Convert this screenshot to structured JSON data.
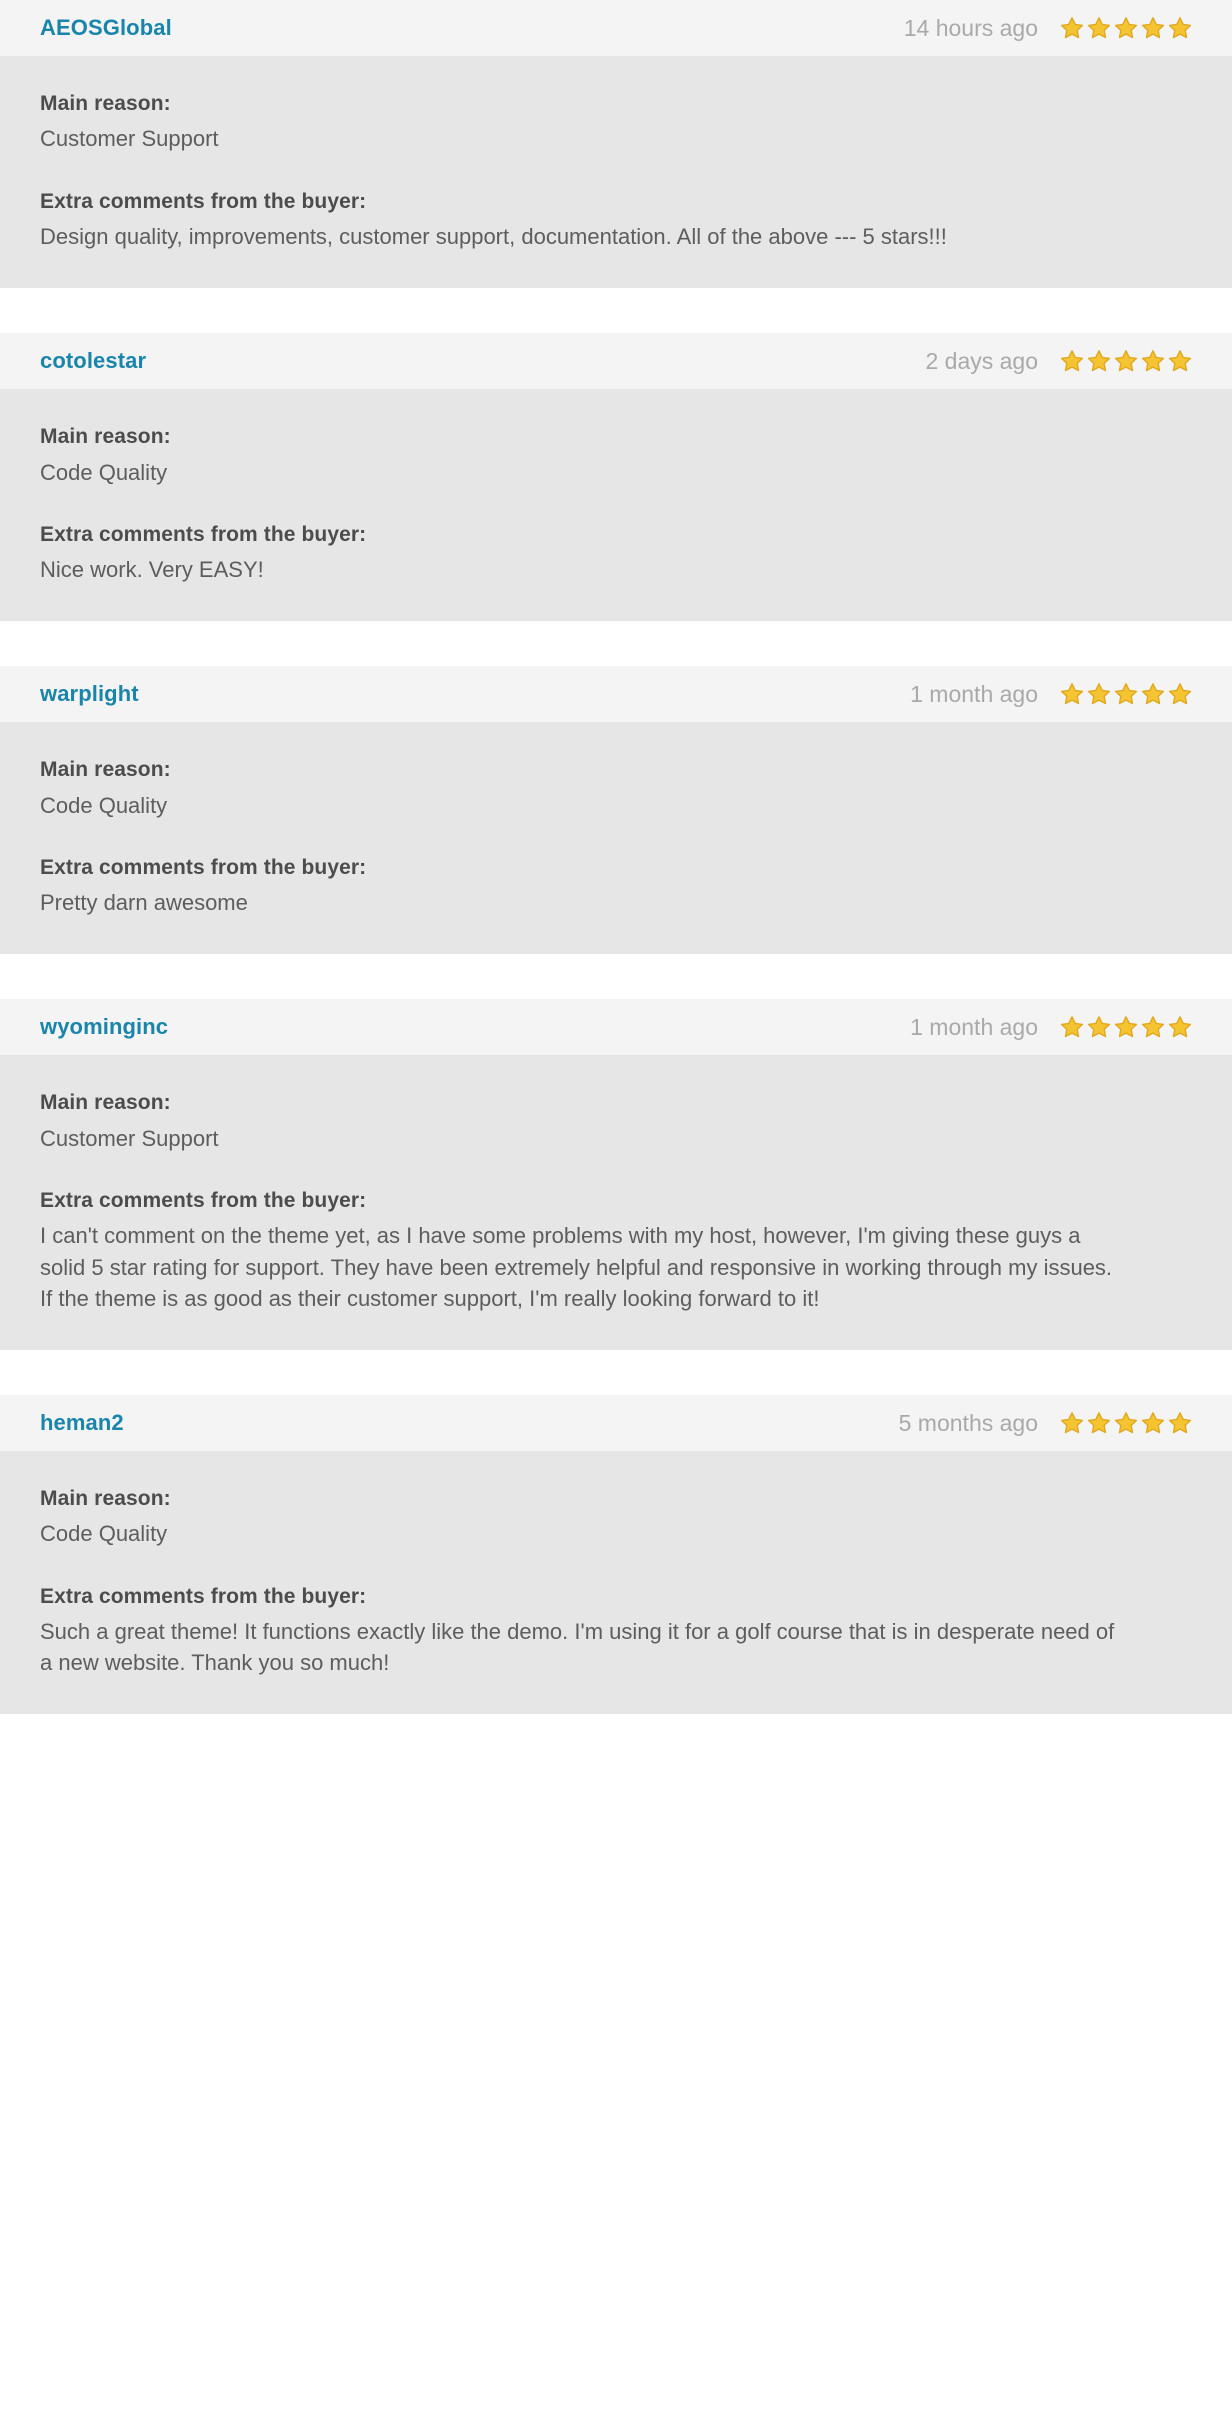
{
  "labels": {
    "main_reason": "Main reason:",
    "extra_comments": "Extra comments from the buyer:"
  },
  "icons": {
    "star": "star-icon"
  },
  "colors": {
    "username": "#1a85ab",
    "timestamp": "#a9a9a9",
    "star_fill": "#f5c432",
    "star_stroke": "#e0a81e",
    "header_bg": "#f4f4f4",
    "body_bg": "#e6e6e6",
    "page_bg": "#ffffff",
    "label_text": "#4c4c4c",
    "body_text": "#5d5d5d"
  },
  "reviews": [
    {
      "username": "AEOSGlobal",
      "time": "14 hours ago",
      "rating": 5,
      "main_reason": "Customer Support",
      "comments": "Design quality, improvements, customer support, documentation. All of the above --- 5 stars!!!"
    },
    {
      "username": "cotolestar",
      "time": "2 days ago",
      "rating": 5,
      "main_reason": "Code Quality",
      "comments": "Nice work. Very EASY!"
    },
    {
      "username": "warplight",
      "time": "1 month ago",
      "rating": 5,
      "main_reason": "Code Quality",
      "comments": "Pretty darn awesome"
    },
    {
      "username": "wyominginc",
      "time": "1 month ago",
      "rating": 5,
      "main_reason": "Customer Support",
      "comments": "I can't comment on the theme yet, as I have some problems with my host, however, I'm giving these guys a solid 5 star rating for support. They have been extremely helpful and responsive in working through my issues. If the theme is as good as their customer support, I'm really looking forward to it!"
    },
    {
      "username": "heman2",
      "time": "5 months ago",
      "rating": 5,
      "main_reason": "Code Quality",
      "comments": "Such a great theme! It functions exactly like the demo. I'm using it for a golf course that is in desperate need of a new website. Thank you so much!"
    }
  ]
}
